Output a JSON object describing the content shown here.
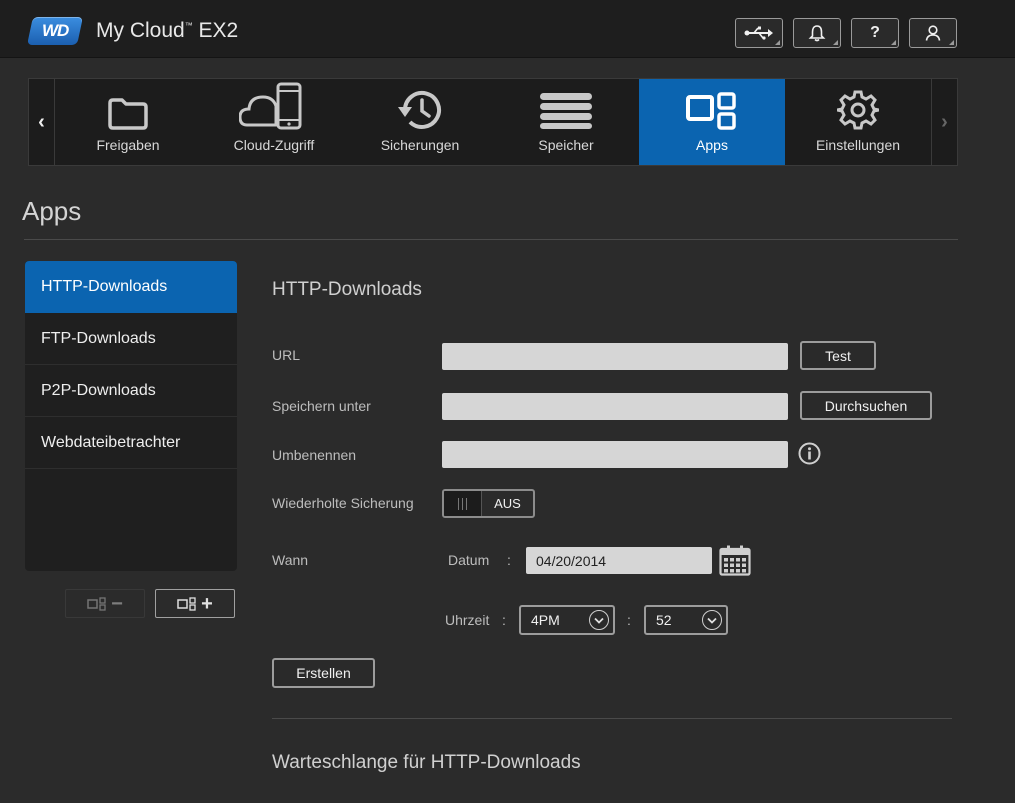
{
  "header": {
    "logo_text": "WD",
    "product_name": "My Cloud",
    "product_tm": "™",
    "product_model": "EX2",
    "buttons": [
      {
        "icon": "usb-icon",
        "glyph": "⇠•"
      },
      {
        "icon": "bell-icon",
        "glyph": "bell"
      },
      {
        "icon": "help-icon",
        "glyph": "?"
      },
      {
        "icon": "user-icon",
        "glyph": "user"
      }
    ]
  },
  "nav": {
    "items": [
      {
        "label": "Freigaben",
        "icon": "folder-icon"
      },
      {
        "label": "Cloud-Zugriff",
        "icon": "cloud-device-icon"
      },
      {
        "label": "Sicherungen",
        "icon": "history-icon"
      },
      {
        "label": "Speicher",
        "icon": "storage-stack-icon"
      },
      {
        "label": "Apps",
        "icon": "apps-grid-icon",
        "active": true
      },
      {
        "label": "Einstellungen",
        "icon": "gear-icon"
      }
    ]
  },
  "page": {
    "title": "Apps"
  },
  "sidebar": {
    "items": [
      {
        "label": "HTTP-Downloads",
        "active": true
      },
      {
        "label": "FTP-Downloads"
      },
      {
        "label": "P2P-Downloads"
      },
      {
        "label": "Webdateibetrachter"
      }
    ],
    "remove_app_symbol": "−",
    "add_app_symbol": "+"
  },
  "form": {
    "title": "HTTP-Downloads",
    "url_label": "URL",
    "url_value": "",
    "test_button": "Test",
    "save_to_label": "Speichern unter",
    "save_to_value": "",
    "browse_button": "Durchsuchen",
    "rename_label": "Umbenennen",
    "rename_value": "",
    "repeat_label": "Wiederholte Sicherung",
    "repeat_state": "AUS",
    "when_label": "Wann",
    "date_label": "Datum",
    "date_sep": ":",
    "date_value": "04/20/2014",
    "time_label": "Uhrzeit",
    "time_sep": ":",
    "hour_value": "4PM",
    "time_colon": ":",
    "minute_value": "52",
    "create_button": "Erstellen"
  },
  "queue": {
    "title": "Warteschlange für HTTP-Downloads"
  },
  "colors": {
    "accent": "#0b64b0",
    "background": "#2b2b2b",
    "input": "#d6d6d6"
  }
}
